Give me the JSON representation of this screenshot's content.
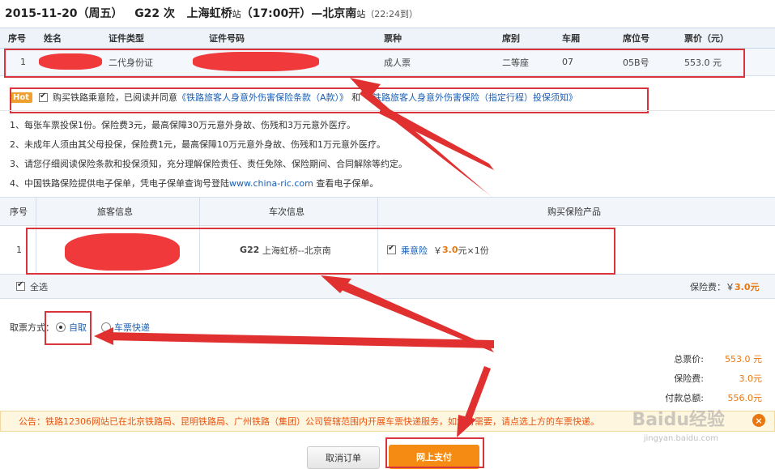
{
  "header": {
    "date": "2015-11-20",
    "weekday": "（周五）",
    "train": "G22",
    "train_suffix": "次",
    "from": "上海虹桥",
    "station_suffix": "站",
    "depart": "（17:00开）",
    "dash": "—",
    "to": "北京南",
    "arrive": "（22:24到）"
  },
  "passenger_table": {
    "headers": [
      "序号",
      "姓名",
      "证件类型",
      "证件号码",
      "票种",
      "席别",
      "车厢",
      "席位号",
      "票价（元）"
    ],
    "row": {
      "index": "1",
      "id_type": "二代身份证",
      "ticket_type": "成人票",
      "seat_class": "二等座",
      "coach": "07",
      "seat_no": "05B号",
      "price": "553.0 元"
    }
  },
  "insurance": {
    "hot": "Hot",
    "text_prefix": "购买铁路乘意险，已阅读并同意",
    "link1": "《铁路旅客人身意外伤害保险条款（A款）》",
    "and": "和",
    "link2": "《铁路旅客人身意外伤害保险（指定行程）投保须知》",
    "notes": [
      "1、每张车票投保1份。保险费3元，最高保障30万元意外身故、伤残和3万元意外医疗。",
      "2、未成年人须由其父母投保，保险费1元，最高保障10万元意外身故、伤残和1万元意外医疗。",
      "3、请您仔细阅读保险条款和投保须知，充分理解保险责任、责任免除、保险期间、合同解除等约定。"
    ],
    "note4_prefix": "4、中国铁路保险提供电子保单，凭电子保单查询号登陆",
    "note4_link": "www.china-ric.com",
    "note4_suffix": "查看电子保单。"
  },
  "insurance_table": {
    "headers": [
      "序号",
      "旅客信息",
      "车次信息",
      "购买保险产品"
    ],
    "row": {
      "index": "1",
      "train": "G22",
      "route": "上海虹桥--北京南",
      "product": "乘意险",
      "price_prefix": "￥",
      "price": "3.0",
      "price_suffix": "元×1份"
    },
    "select_all": "全选",
    "fee_label": "保险费：￥",
    "fee_value": "3.0元"
  },
  "pickup": {
    "label": "取票方式：",
    "option_self": "自取",
    "option_express": "车票快递"
  },
  "totals": {
    "ticket_label": "总票价:",
    "ticket_value": "553.0 元",
    "insurance_label": "保险费:",
    "insurance_value": "3.0元",
    "payable_label": "付款总额:",
    "payable_value": "556.0元"
  },
  "notice": {
    "text": "公告：铁路12306网站已在北京铁路局、昆明铁路局、广州铁路（集团）公司管辖范围内开展车票快递服务，如您有需要，请点选上方的车票快递。",
    "close": "×"
  },
  "buttons": {
    "cancel": "取消订单",
    "pay": "网上支付"
  },
  "watermark": {
    "logo": "Baidu经验",
    "url": "jingyan.baidu.com"
  },
  "colors": {
    "annotation_red": "#d9343c",
    "accent_orange": "#f58b13",
    "link_blue": "#1a5fb4",
    "header_bg": "#eef3fa"
  }
}
